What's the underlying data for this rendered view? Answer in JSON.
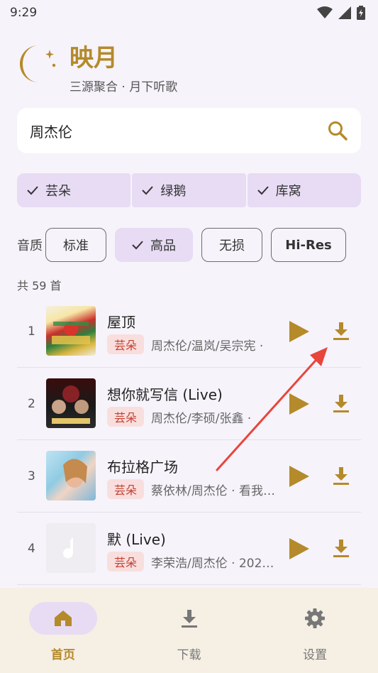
{
  "status_bar": {
    "time": "9:29"
  },
  "header": {
    "title": "映月",
    "subtitle": "三源聚合 · 月下听歌"
  },
  "search": {
    "value": "周杰伦"
  },
  "sources": [
    {
      "label": "芸朵",
      "selected": true
    },
    {
      "label": "绿鹅",
      "selected": true
    },
    {
      "label": "库窝",
      "selected": true
    }
  ],
  "quality": {
    "label": "音质",
    "options": [
      {
        "label": "标准",
        "selected": false
      },
      {
        "label": "高品",
        "selected": true
      },
      {
        "label": "无损",
        "selected": false
      },
      {
        "label": "Hi-Res",
        "selected": false
      }
    ]
  },
  "results": {
    "count_label": "共 59 首",
    "songs": [
      {
        "index": "1",
        "title": "屋顶",
        "source": "芸朵",
        "artist": "周杰伦/温岚/吴宗宪 ·"
      },
      {
        "index": "2",
        "title": "想你就写信 (Live)",
        "source": "芸朵",
        "artist": "周杰伦/李硕/张鑫 ·"
      },
      {
        "index": "3",
        "title": "布拉格广场",
        "source": "芸朵",
        "artist": "蔡依林/周杰伦 · 看我…"
      },
      {
        "index": "4",
        "title": "默 (Live)",
        "source": "芸朵",
        "artist": "李荣浩/周杰伦 · 202…"
      }
    ]
  },
  "nav": {
    "items": [
      {
        "label": "首页",
        "icon": "home-icon",
        "active": true
      },
      {
        "label": "下载",
        "icon": "download-icon",
        "active": false
      },
      {
        "label": "设置",
        "icon": "settings-icon",
        "active": false
      }
    ]
  },
  "colors": {
    "accent": "#b48a2a",
    "chip": "#e7dcf4",
    "badge_bg": "#f9dede",
    "badge_text": "#c2402f",
    "annotation": "#e8453c"
  }
}
